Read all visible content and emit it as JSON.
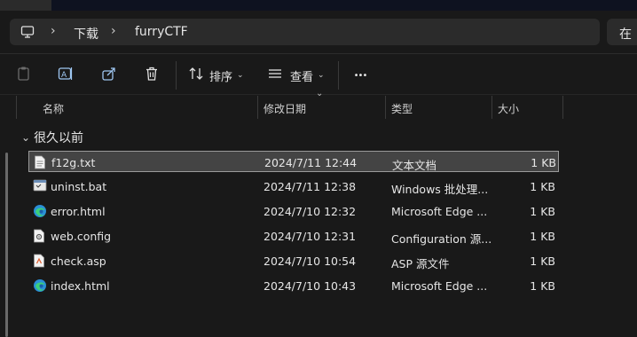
{
  "address": {
    "crumbs": [
      "下载",
      "furryCTF"
    ],
    "search_text": "在"
  },
  "toolbar": {
    "sort_label": "排序",
    "view_label": "查看",
    "more_label": "•••"
  },
  "columns": {
    "name": "名称",
    "modified": "修改日期",
    "type": "类型",
    "size": "大小"
  },
  "group": {
    "label": "很久以前"
  },
  "files": [
    {
      "name": "f12g.txt",
      "modified": "2024/7/11 12:44",
      "type": "文本文档",
      "size": "1 KB",
      "icon": "text-file-icon",
      "selected": true
    },
    {
      "name": "uninst.bat",
      "modified": "2024/7/11 12:38",
      "type": "Windows 批处理...",
      "size": "1 KB",
      "icon": "batch-file-icon",
      "selected": false
    },
    {
      "name": "error.html",
      "modified": "2024/7/10 12:32",
      "type": "Microsoft Edge ...",
      "size": "1 KB",
      "icon": "edge-html-icon",
      "selected": false
    },
    {
      "name": "web.config",
      "modified": "2024/7/10 12:31",
      "type": "Configuration 源...",
      "size": "1 KB",
      "icon": "config-file-icon",
      "selected": false
    },
    {
      "name": "check.asp",
      "modified": "2024/7/10 10:54",
      "type": "ASP 源文件",
      "size": "1 KB",
      "icon": "asp-file-icon",
      "selected": false
    },
    {
      "name": "index.html",
      "modified": "2024/7/10 10:43",
      "type": "Microsoft Edge ...",
      "size": "1 KB",
      "icon": "edge-html-icon",
      "selected": false
    }
  ]
}
